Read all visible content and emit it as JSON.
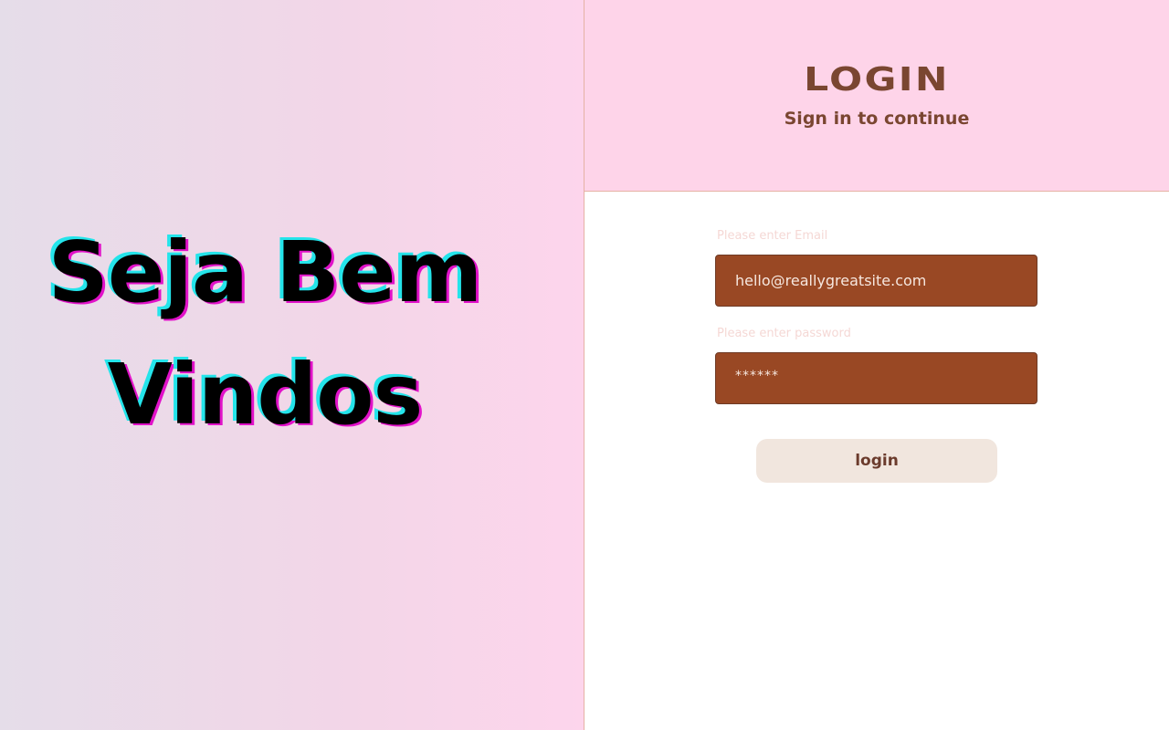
{
  "welcome": {
    "line1": "Seja Bem",
    "line2": "Vindos"
  },
  "header": {
    "title": "LOGIN",
    "subtitle": "Sign in to continue"
  },
  "form": {
    "email_label": "Please enter Email",
    "email_value": "hello@reallygreatsite.com",
    "password_label": "Please enter password",
    "password_value": "******",
    "submit_label": "login"
  },
  "colors": {
    "accent_brown": "#7a4631",
    "field_fill": "#994824",
    "header_pink": "#fed4e9",
    "button_fill": "#f1e6de",
    "shadow_cyan": "#24e4ea",
    "shadow_magenta": "#e112c9"
  }
}
